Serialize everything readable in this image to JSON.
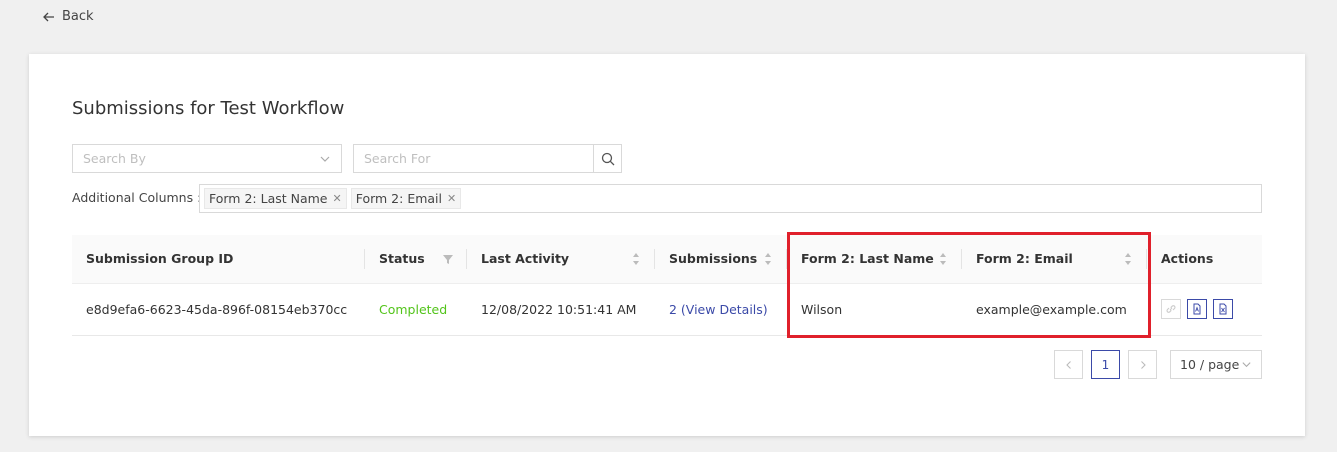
{
  "nav": {
    "back_label": "Back"
  },
  "page": {
    "title": "Submissions for Test Workflow"
  },
  "search": {
    "by_placeholder": "Search By",
    "for_placeholder": "Search For"
  },
  "additional_columns": {
    "label": "Additional Columns :",
    "tags": [
      "Form 2: Last Name",
      "Form 2: Email"
    ]
  },
  "table": {
    "headers": {
      "group_id": "Submission Group ID",
      "status": "Status",
      "last_activity": "Last Activity",
      "submissions": "Submissions",
      "last_name": "Form 2: Last Name",
      "email": "Form 2: Email",
      "actions": "Actions"
    },
    "rows": [
      {
        "group_id": "e8d9efa6-6623-45da-896f-08154eb370cc",
        "status": "Completed",
        "last_activity": "12/08/2022 10:51:41 AM",
        "submissions": "2 (View Details)",
        "last_name": "Wilson",
        "email": "example@example.com"
      }
    ]
  },
  "pagination": {
    "current_page": "1",
    "page_size": "10 / page"
  },
  "colors": {
    "accent": "#3b4aa8",
    "completed": "#52c41a",
    "highlight": "#e0202b"
  }
}
